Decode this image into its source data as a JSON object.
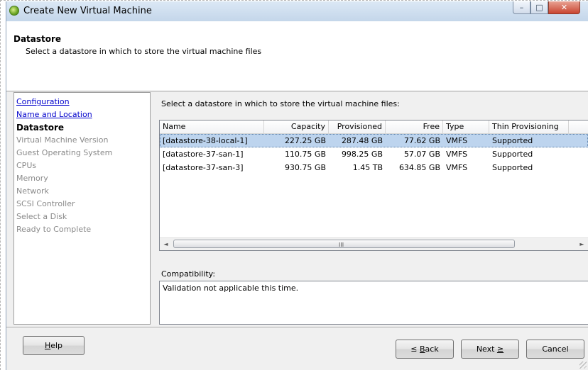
{
  "window": {
    "title": "Create New Virtual Machine",
    "min_glyph": "–",
    "max_glyph": "□",
    "close_glyph": "✕"
  },
  "header": {
    "title": "Datastore",
    "subtitle": "Select a datastore in which to store the virtual machine files"
  },
  "nav": {
    "items": [
      {
        "label": "Configuration",
        "state": "done"
      },
      {
        "label": "Name and Location",
        "state": "done"
      },
      {
        "label": "Datastore",
        "state": "current"
      },
      {
        "label": "Virtual Machine Version",
        "state": "pending"
      },
      {
        "label": "Guest Operating System",
        "state": "pending"
      },
      {
        "label": "CPUs",
        "state": "pending"
      },
      {
        "label": "Memory",
        "state": "pending"
      },
      {
        "label": "Network",
        "state": "pending"
      },
      {
        "label": "SCSI Controller",
        "state": "pending"
      },
      {
        "label": "Select a Disk",
        "state": "pending"
      },
      {
        "label": "Ready to Complete",
        "state": "pending"
      }
    ]
  },
  "main": {
    "instruction": "Select a datastore in which to store the virtual machine files:",
    "table": {
      "columns": [
        "Name",
        "Capacity",
        "Provisioned",
        "Free",
        "Type",
        "Thin Provisioning"
      ],
      "rows": [
        {
          "name": "[datastore-38-local-1]",
          "capacity": "227.25 GB",
          "provisioned": "287.48 GB",
          "free": "77.62 GB",
          "type": "VMFS",
          "thin": "Supported",
          "selected": true
        },
        {
          "name": "[datastore-37-san-1]",
          "capacity": "110.75 GB",
          "provisioned": "998.25 GB",
          "free": "57.07 GB",
          "type": "VMFS",
          "thin": "Supported",
          "selected": false
        },
        {
          "name": "[datastore-37-san-3]",
          "capacity": "930.75 GB",
          "provisioned": "1.45 TB",
          "free": "634.85 GB",
          "type": "VMFS",
          "thin": "Supported",
          "selected": false
        }
      ],
      "scroll_left": "◄",
      "scroll_right": "►",
      "scroll_grip": "III"
    },
    "compatibility_label": "Compatibility:",
    "compatibility_text": "Validation not applicable this time."
  },
  "footer": {
    "help": {
      "accel": "H",
      "rest": "elp"
    },
    "back": {
      "prefix": "≤ ",
      "accel": "B",
      "rest": "ack"
    },
    "next": {
      "prefix": "Next ",
      "accel": "≥",
      "rest": ""
    },
    "cancel": "Cancel"
  },
  "colors": {
    "title_bar": "#c4d6ea",
    "selection": "#bdd4ee",
    "link": "#0000cc",
    "close_button": "#c94530"
  }
}
